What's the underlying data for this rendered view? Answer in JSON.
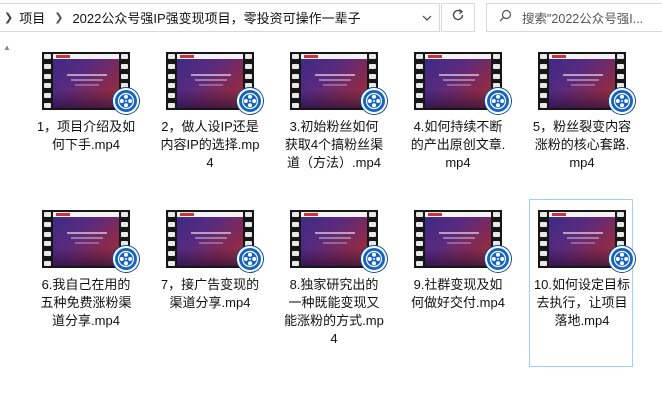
{
  "address_bar": {
    "crumbs": [
      "项目",
      "2022公众号强IP强变现项目，零投资可操作一辈子"
    ],
    "search_placeholder": "搜索\"2022公众号强I..."
  },
  "icons": {
    "chevron": "chevron-right-icon",
    "dropdown": "chevron-down-icon",
    "refresh": "refresh-icon",
    "search": "search-icon",
    "badge": "video-player-badge-icon"
  },
  "colors": {
    "selection_border": "#99d1ff",
    "badge": "#1565c0"
  },
  "files": [
    {
      "label": "1，项目介绍及如何下手.mp4"
    },
    {
      "label": "2，做人设IP还是内容IP的选择.mp4"
    },
    {
      "label": "3.初始粉丝如何获取4个搞粉丝渠道（方法）.mp4"
    },
    {
      "label": "4.如何持续不断的产出原创文章.mp4"
    },
    {
      "label": "5，粉丝裂变内容涨粉的核心套路.mp4"
    },
    {
      "label": "6.我自己在用的五种免费涨粉渠道分享.mp4"
    },
    {
      "label": "7，接广告变现的渠道分享.mp4"
    },
    {
      "label": "8.独家研究出的一种既能变现又能涨粉的方式.mp4"
    },
    {
      "label": "9.社群变现及如何做好交付.mp4"
    },
    {
      "label": "10.如何设定目标去执行，让项目落地.mp4"
    }
  ]
}
